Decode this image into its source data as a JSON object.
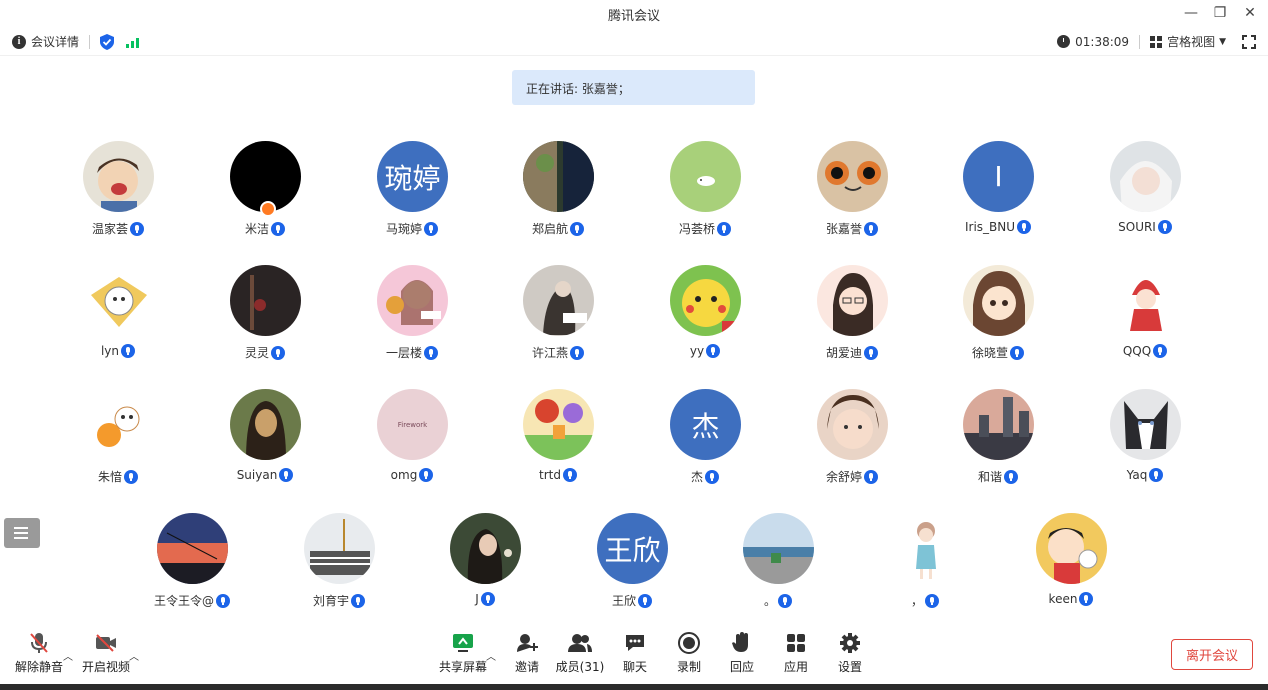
{
  "window": {
    "title": "腾讯会议",
    "minimize": "—",
    "restore": "❐",
    "close": "✕"
  },
  "infobar": {
    "meeting_details": "会议详情",
    "timer": "01:38:09",
    "view_mode": "宫格视图"
  },
  "speaking": {
    "text": "正在讲话: 张嘉誉；"
  },
  "participants": [
    {
      "name": "温家荟"
    },
    {
      "name": "米洁"
    },
    {
      "name": "马琬婷",
      "avatar_text": "琬婷"
    },
    {
      "name": "郑启航"
    },
    {
      "name": "冯荟桥"
    },
    {
      "name": "张嘉誉"
    },
    {
      "name": "Iris_BNU",
      "avatar_text": "I"
    },
    {
      "name": "SOURI"
    },
    {
      "name": "lyn"
    },
    {
      "name": "灵灵"
    },
    {
      "name": "一层楼"
    },
    {
      "name": "许江燕"
    },
    {
      "name": "yy"
    },
    {
      "name": "胡爱迪"
    },
    {
      "name": "徐晓萱"
    },
    {
      "name": "QQQ"
    },
    {
      "name": "朱愔"
    },
    {
      "name": "Suiyan"
    },
    {
      "name": "omg",
      "avatar_text": "Firework"
    },
    {
      "name": "trtd"
    },
    {
      "name": "杰",
      "avatar_text": "杰"
    },
    {
      "name": "余舒婷"
    },
    {
      "name": "和谐"
    },
    {
      "name": "Yaq"
    },
    {
      "name": "王令王令@"
    },
    {
      "name": "刘育宇"
    },
    {
      "name": "J"
    },
    {
      "name": "王欣",
      "avatar_text": "王欣"
    },
    {
      "name": "。"
    },
    {
      "name": "，"
    },
    {
      "name": "keen"
    }
  ],
  "toolbar": {
    "unmute": "解除静音",
    "start_video": "开启视频",
    "share_screen": "共享屏幕",
    "invite": "邀请",
    "members": "成员(31)",
    "chat": "聊天",
    "record": "录制",
    "reactions": "回应",
    "apps": "应用",
    "settings": "设置",
    "leave": "离开会议"
  },
  "colors": {
    "accent": "#1c64e8",
    "text_avatar_bg": "#3e6fbf",
    "leave": "#e0473e",
    "banner": "#dbe9fb",
    "host": "#ff7a22"
  }
}
